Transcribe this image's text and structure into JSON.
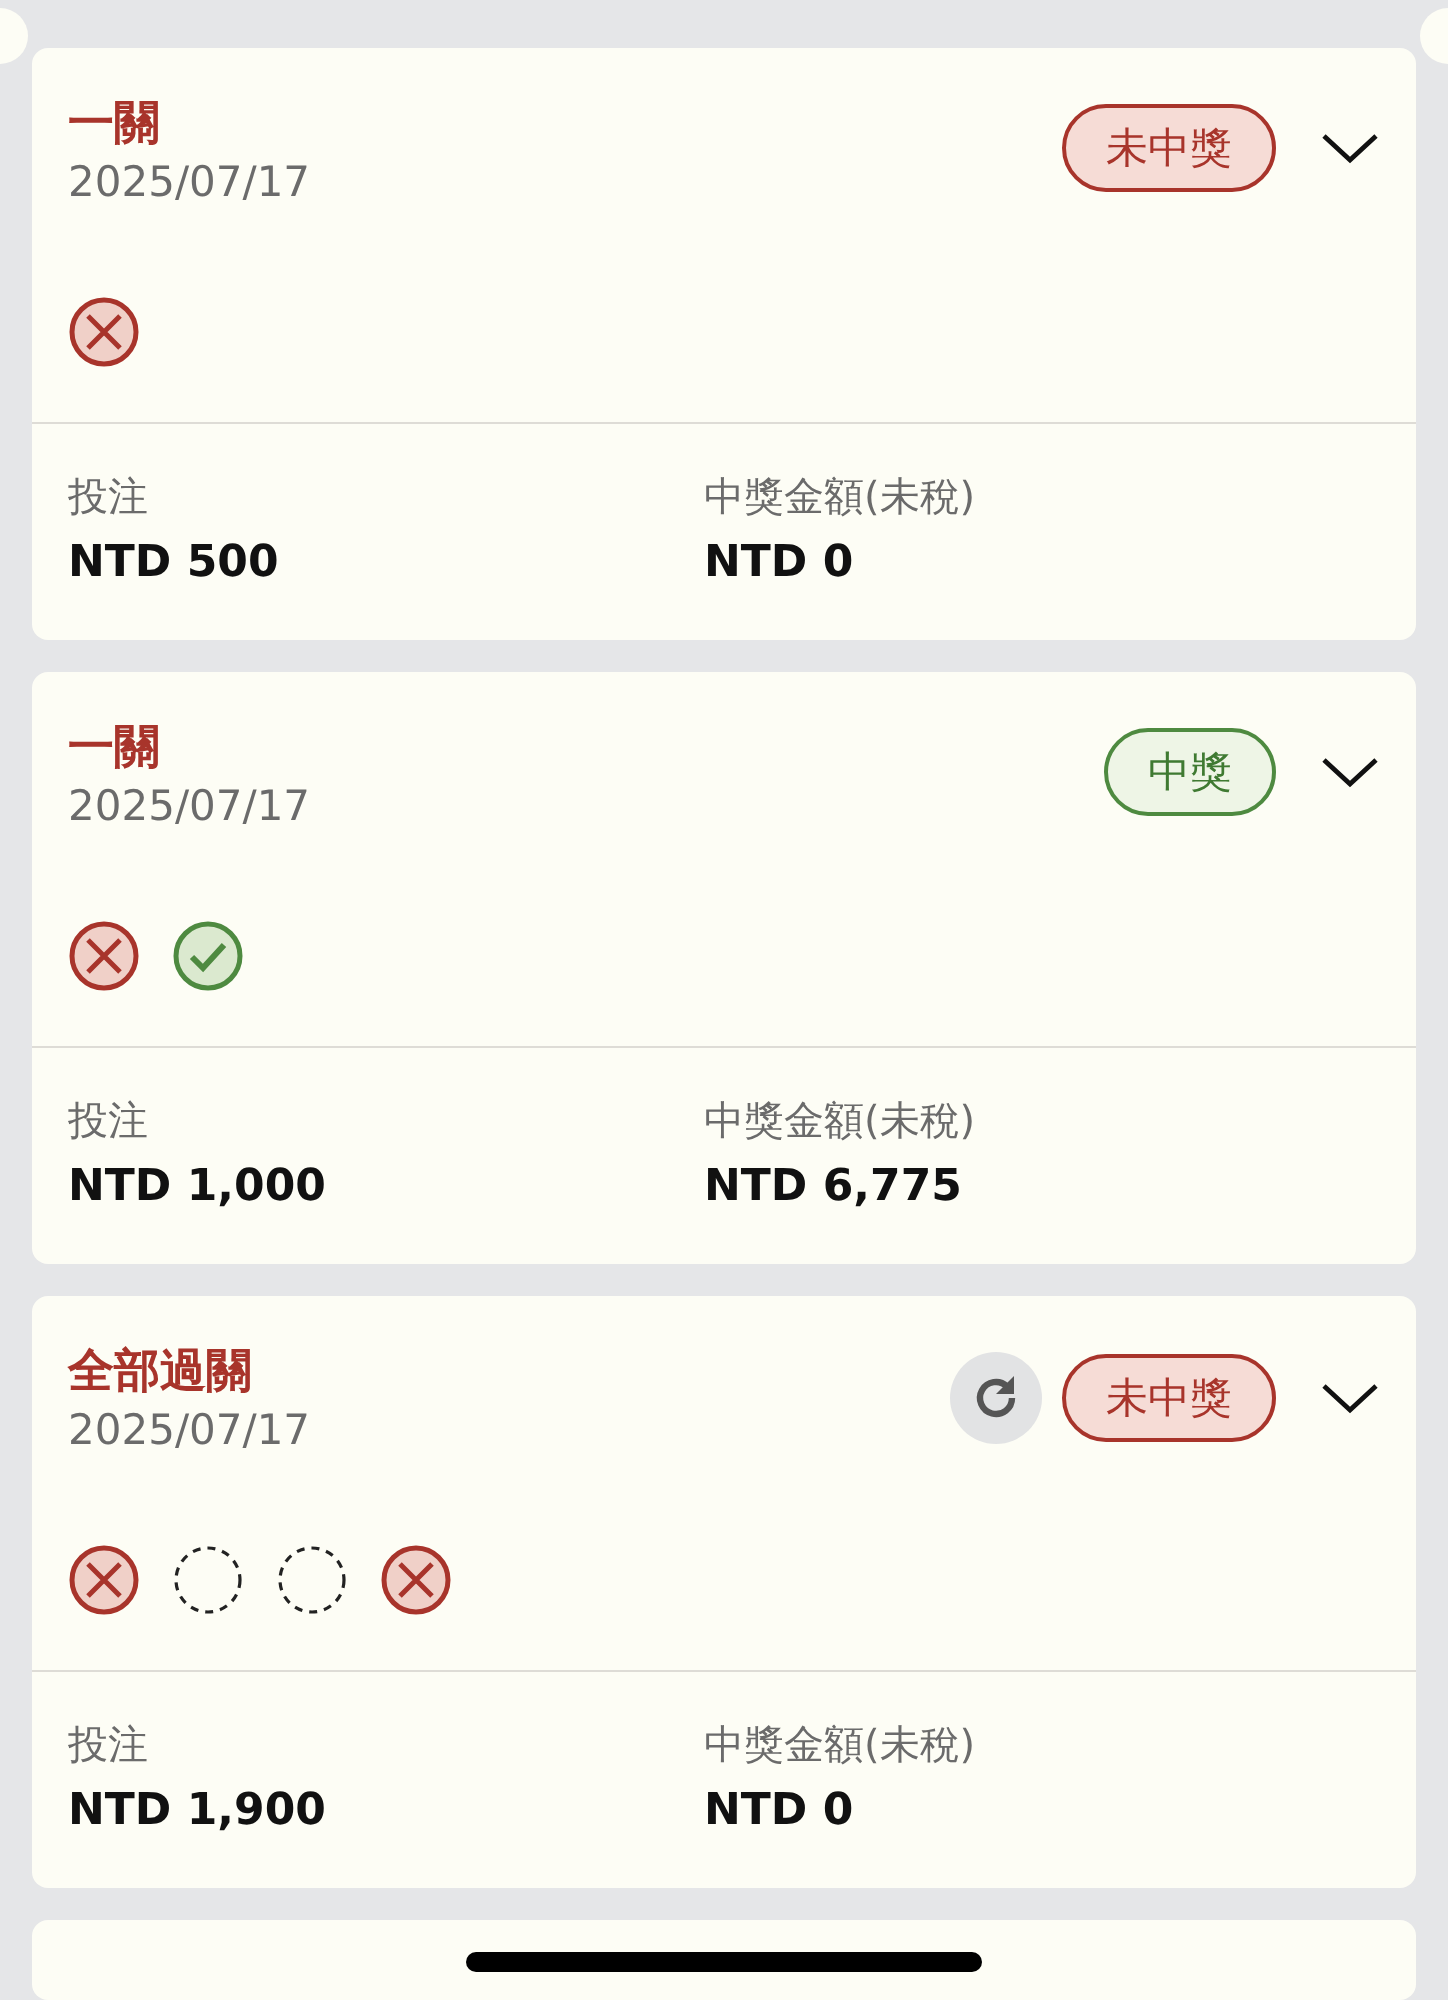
{
  "bets": [
    {
      "title": "一關",
      "date": "2025/07/17",
      "refresh": false,
      "status": {
        "kind": "lost",
        "label": "未中獎"
      },
      "expanded": false,
      "legs": [
        {
          "kind": "lost"
        }
      ],
      "stake_label": "投注",
      "stake": "NTD 500",
      "payout_label": "中獎金額(未稅)",
      "payout": "NTD 0"
    },
    {
      "title": "一關",
      "date": "2025/07/17",
      "refresh": false,
      "status": {
        "kind": "won",
        "label": "中獎"
      },
      "expanded": false,
      "legs": [
        {
          "kind": "lost"
        },
        {
          "kind": "won"
        }
      ],
      "stake_label": "投注",
      "stake": "NTD 1,000",
      "payout_label": "中獎金額(未稅)",
      "payout": "NTD 6,775"
    },
    {
      "title": "全部過關",
      "date": "2025/07/17",
      "refresh": true,
      "status": {
        "kind": "lost",
        "label": "未中獎"
      },
      "expanded": false,
      "legs": [
        {
          "kind": "lost"
        },
        {
          "kind": "pending"
        },
        {
          "kind": "pending"
        },
        {
          "kind": "lost"
        }
      ],
      "stake_label": "投注",
      "stake": "NTD 1,900",
      "payout_label": "中獎金額(未稅)",
      "payout": "NTD 0"
    }
  ]
}
